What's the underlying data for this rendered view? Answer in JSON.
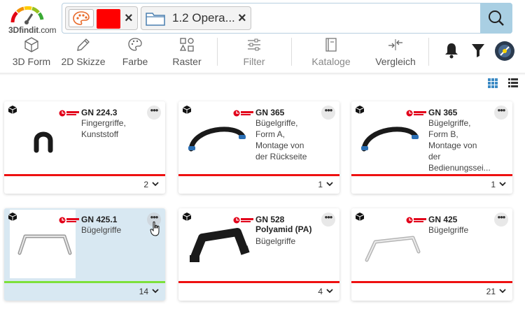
{
  "logo": {
    "text_a": "3D",
    "text_b": "findit",
    "text_c": ".com"
  },
  "search": {
    "chip_color": {
      "color": "#ff0000",
      "icon": "palette-icon",
      "close": "×"
    },
    "chip_catalog": {
      "label": "1.2 Opera...",
      "icon": "folder-icon",
      "close": "×"
    },
    "button_icon": "search-icon"
  },
  "toolbar": {
    "items": [
      {
        "label": "3D Form",
        "icon": "cube-icon"
      },
      {
        "label": "2D Skizze",
        "icon": "pencil-icon"
      },
      {
        "label": "Farbe",
        "icon": "palette-icon"
      },
      {
        "label": "Raster",
        "icon": "grid-shapes-icon"
      },
      {
        "label": "Filter",
        "icon": "sliders-icon"
      },
      {
        "label": "Kataloge",
        "icon": "catalog-icon"
      },
      {
        "label": "Vergleich",
        "icon": "compare-icon"
      }
    ],
    "right_icons": [
      "bell-icon",
      "funnel-icon",
      "user-avatar-icon"
    ]
  },
  "colors": {
    "accent": "#a9cfe3",
    "brand_red": "#e2001a",
    "bar_red": "#ee1111",
    "bar_green": "#7de03a",
    "active_card": "#d8e8f2"
  },
  "cards": [
    {
      "title": "GN 224.3",
      "lines": [
        "Fingergriffe,",
        "Kunststoff"
      ],
      "bold_line": "",
      "count": "2"
    },
    {
      "title": "GN 365",
      "lines": [
        "Bügelgriffe,",
        "Form A,",
        "Montage von",
        "der Rückseite"
      ],
      "bold_line": "",
      "count": "1"
    },
    {
      "title": "GN 365",
      "lines": [
        "Bügelgriffe,",
        "Form B,",
        "Montage von",
        "der",
        "Bedienungssei..."
      ],
      "bold_line": "",
      "count": "1"
    },
    {
      "title": "GN 425.1",
      "lines": [
        "Bügelgriffe"
      ],
      "bold_line": "",
      "count": "14"
    },
    {
      "title": "GN 528",
      "lines": [
        "Bügelgriffe"
      ],
      "bold_line": "Polyamid (PA)",
      "count": "4"
    },
    {
      "title": "GN 425",
      "lines": [
        "Bügelgriffe"
      ],
      "bold_line": "",
      "count": "21"
    }
  ],
  "more_glyph": "•••"
}
